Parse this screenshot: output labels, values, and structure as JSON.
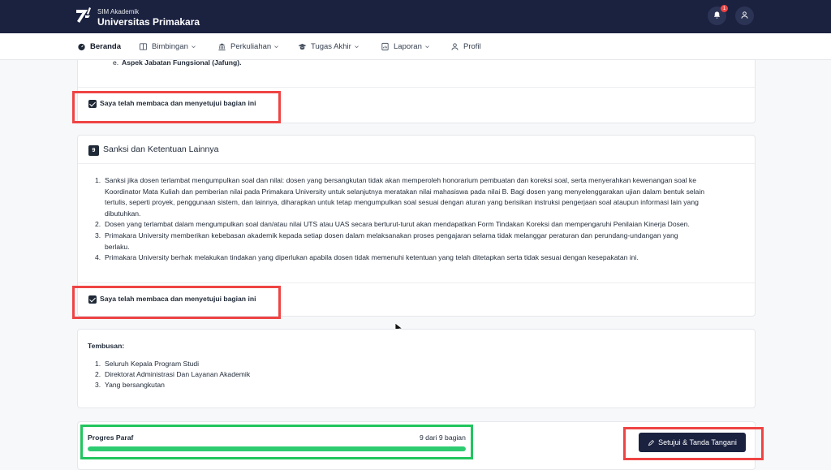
{
  "header": {
    "subtitle": "SIM Akademik",
    "title": "Universitas Primakara",
    "notification_count": "1"
  },
  "nav": {
    "items": [
      {
        "label": "Beranda",
        "icon": "dashboard-icon"
      },
      {
        "label": "Bimbingan",
        "icon": "book-icon"
      },
      {
        "label": "Perkuliahan",
        "icon": "building-icon"
      },
      {
        "label": "Tugas Akhir",
        "icon": "graduation-cap-icon"
      },
      {
        "label": "Laporan",
        "icon": "report-icon"
      },
      {
        "label": "Profil",
        "icon": "user-icon"
      }
    ]
  },
  "section8": {
    "item_e_marker": "e.",
    "item_e": "Aspek Jabatan Fungsional (Jafung).",
    "agree_label": "Saya telah membaca dan menyetujui bagian ini"
  },
  "section9": {
    "number": "9",
    "title": "Sanksi dan Ketentuan Lainnya",
    "items": [
      {
        "num": "1.",
        "lines": [
          "Sanksi jika dosen terlambat mengumpulkan soal dan nilai: dosen yang bersangkutan tidak akan memperoleh honorarium pembuatan dan koreksi soal, serta menyerahkan kewenangan soal ke",
          "Koordinator Mata Kuliah dan pemberian nilai pada Primakara University untuk selanjutnya meratakan nilai mahasiswa pada nilai B. Bagi dosen yang menyelenggarakan ujian dalam bentuk selain",
          "tertulis, seperti proyek, penggunaan sistem, dan lainnya, diharapkan untuk tetap mengumpulkan soal sesuai dengan aturan yang berisikan instruksi pengerjaan soal ataupun informasi lain yang",
          "dibutuhkan."
        ]
      },
      {
        "num": "2.",
        "lines": [
          "Dosen yang terlambat dalam mengumpulkan soal dan/atau nilai UTS atau UAS secara berturut-turut akan mendapatkan Form Tindakan Koreksi dan mempengaruhi Penilaian Kinerja Dosen."
        ]
      },
      {
        "num": "3.",
        "lines": [
          "Primakara University memberikan kebebasan akademik kepada setiap dosen dalam melaksanakan proses pengajaran selama tidak melanggar peraturan dan perundang-undangan yang",
          "berlaku."
        ]
      },
      {
        "num": "4.",
        "lines": [
          "Primakara University berhak melakukan tindakan yang diperlukan apabila dosen tidak memenuhi ketentuan yang telah ditetapkan serta tidak sesuai dengan kesepakatan ini."
        ]
      }
    ],
    "agree_label": "Saya telah membaca dan menyetujui bagian ini"
  },
  "tembusan": {
    "title": "Tembusan:",
    "items": [
      {
        "num": "1.",
        "text": "Seluruh Kepala Program Studi"
      },
      {
        "num": "2.",
        "text": "Direktorat Administrasi Dan Layanan Akademik"
      },
      {
        "num": "3.",
        "text": "Yang bersangkutan"
      }
    ]
  },
  "progress": {
    "label": "Progres Paraf",
    "count_text": "9 dari 9 bagian",
    "completed": 9,
    "total": 9,
    "button_label": "Setujui & Tanda Tangani"
  },
  "colors": {
    "navy": "#1b2240",
    "highlight_red": "#ef4444",
    "highlight_green": "#22c55e",
    "progress_fill": "#2ecc71"
  }
}
